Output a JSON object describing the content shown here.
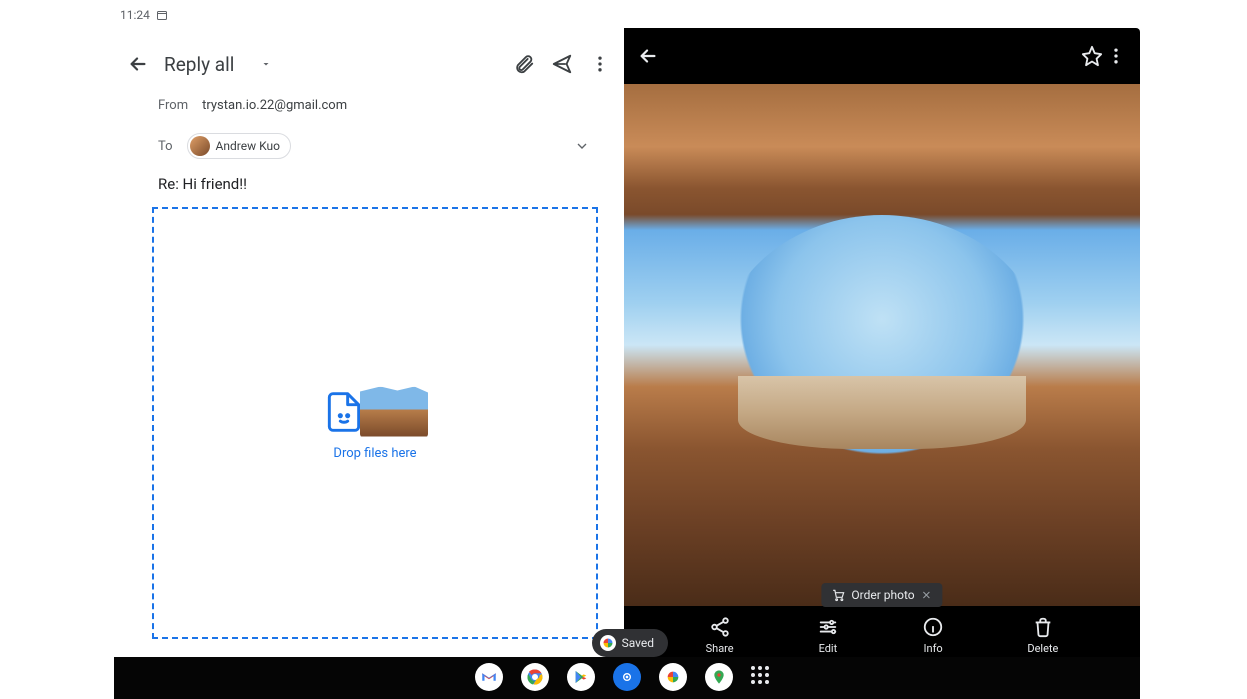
{
  "status": {
    "time": "11:24"
  },
  "gmail": {
    "header": {
      "title": "Reply all"
    },
    "toolbar": {
      "back": "back-icon",
      "attach": "attachment-icon",
      "send": "send-icon",
      "more": "more-vert-icon"
    },
    "from_label": "From",
    "from_value": "trystan.io.22@gmail.com",
    "to_label": "To",
    "to_chip": {
      "name": "Andrew Kuo"
    },
    "subject": "Re: Hi friend!!",
    "drop_text": "Drop files here",
    "saved_label": "Saved"
  },
  "photos": {
    "order_label": "Order photo",
    "actions": {
      "share": "Share",
      "edit": "Edit",
      "info": "Info",
      "delete": "Delete"
    }
  },
  "dock": {
    "apps": [
      "Gmail",
      "Chrome",
      "Play Store",
      "Camera",
      "Photos",
      "Maps",
      "All apps"
    ]
  }
}
